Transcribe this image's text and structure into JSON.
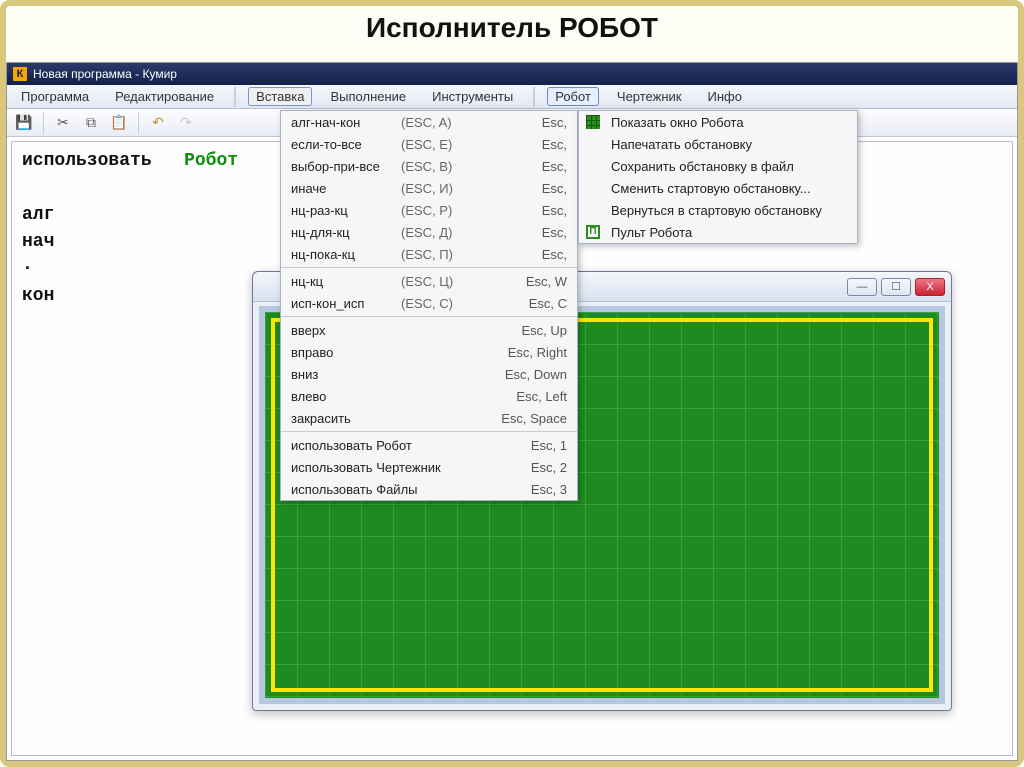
{
  "slide_title": "Исполнитель РОБОТ",
  "titlebar": {
    "k": "К",
    "text": "Новая программа - Кумир"
  },
  "menubar": {
    "program": "Программа",
    "edit": "Редактирование",
    "insert": "Вставка",
    "run": "Выполнение",
    "tools": "Инструменты",
    "robot": "Робот",
    "drafter": "Чертежник",
    "info": "Инфо"
  },
  "editor": {
    "use_kw": "использовать",
    "robot_kw": "Робот",
    "alg": "алг",
    "nach": "нач",
    "dot": "·",
    "kon": "кон"
  },
  "insert_menu": {
    "groups": [
      [
        {
          "c1": "алг-нач-кон",
          "c2": "(ESC, A)",
          "c3": "Esc,"
        },
        {
          "c1": "если-то-все",
          "c2": "(ESC, E)",
          "c3": "Esc,"
        },
        {
          "c1": "выбор-при-все",
          "c2": "(ESC, B)",
          "c3": "Esc,"
        },
        {
          "c1": "иначе",
          "c2": "(ESC, И)",
          "c3": "Esc,"
        },
        {
          "c1": "нц-раз-кц",
          "c2": "(ESC, Р)",
          "c3": "Esc,"
        },
        {
          "c1": "нц-для-кц",
          "c2": "(ESC, Д)",
          "c3": "Esc,"
        },
        {
          "c1": "нц-пока-кц",
          "c2": "(ESC, П)",
          "c3": "Esc,"
        }
      ],
      [
        {
          "c1": "нц-кц",
          "c2": "(ESC, Ц)",
          "c3": "Esc, W"
        },
        {
          "c1": "исп-кон_исп",
          "c2": "(ESC, С)",
          "c3": "Esc, C"
        }
      ],
      [
        {
          "c1": "вверх",
          "c2": "",
          "c3": "Esc, Up"
        },
        {
          "c1": "вправо",
          "c2": "",
          "c3": "Esc, Right"
        },
        {
          "c1": "вниз",
          "c2": "",
          "c3": "Esc, Down"
        },
        {
          "c1": "влево",
          "c2": "",
          "c3": "Esc, Left"
        },
        {
          "c1": "закрасить",
          "c2": "",
          "c3": "Esc, Space"
        }
      ],
      [
        {
          "c1": "использовать Робот",
          "c2": "",
          "c3": "Esc, 1"
        },
        {
          "c1": "использовать Чертежник",
          "c2": "",
          "c3": "Esc, 2"
        },
        {
          "c1": "использовать Файлы",
          "c2": "",
          "c3": "Esc, 3"
        }
      ]
    ]
  },
  "robot_menu": {
    "items": [
      {
        "icon": "grid",
        "label": "Показать окно Робота"
      },
      {
        "icon": "",
        "label": "Напечатать обстановку"
      },
      {
        "icon": "",
        "label": "Сохранить обстановку в файл"
      },
      {
        "icon": "",
        "label": "Сменить стартовую обстановку..."
      },
      {
        "icon": "",
        "label": "Вернуться в стартовую обстановку"
      },
      {
        "icon": "pi",
        "label": "Пульт Робота"
      }
    ]
  },
  "winctl": {
    "min": "—",
    "max": "☐",
    "close": "X"
  }
}
